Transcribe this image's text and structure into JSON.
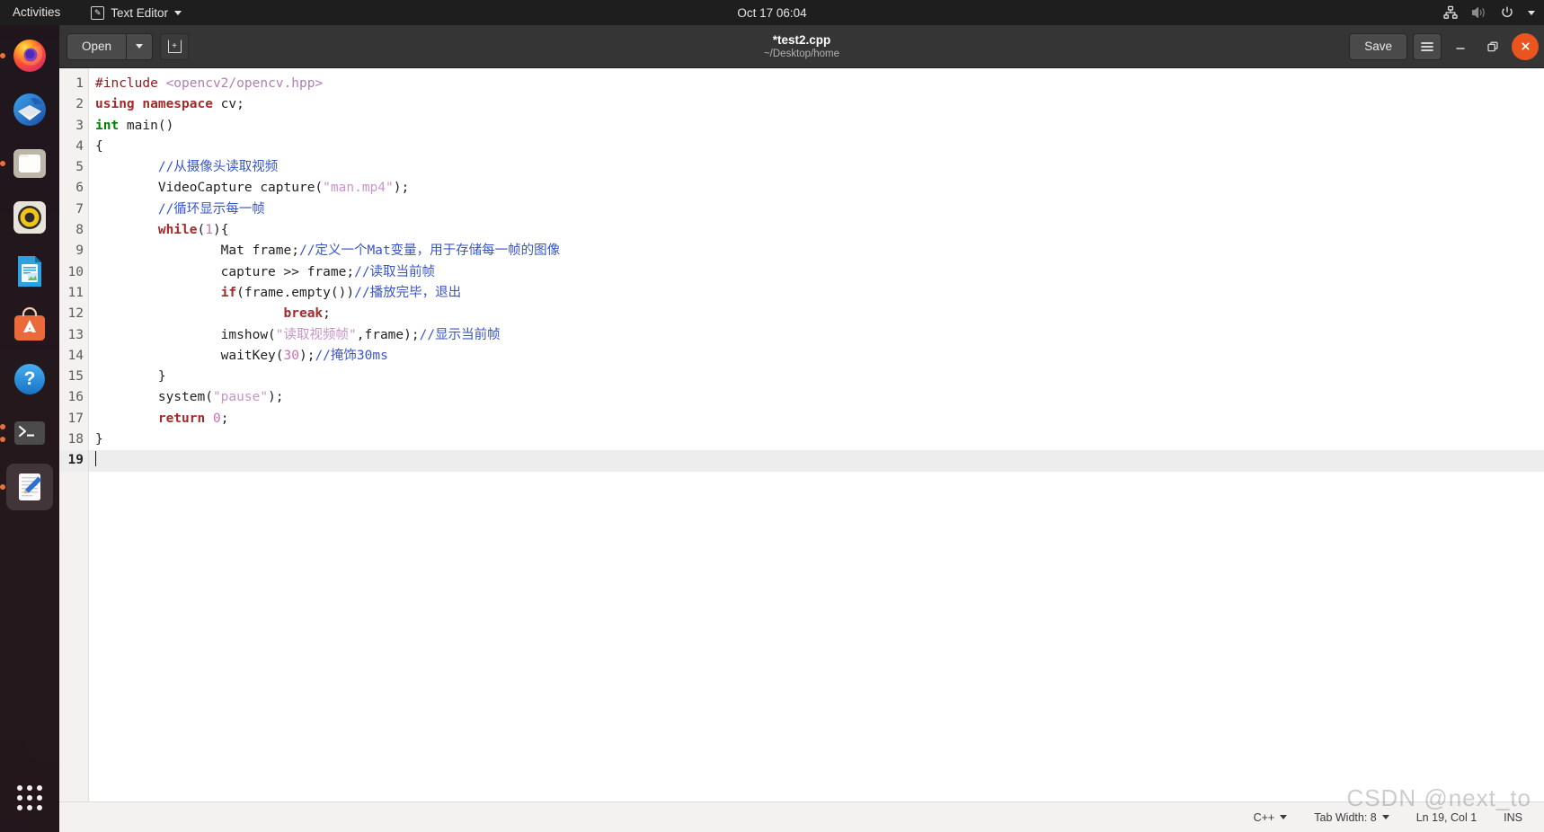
{
  "topbar": {
    "activities": "Activities",
    "app_name": "Text Editor",
    "app_icon": "text-editor-icon",
    "clock": "Oct 17  06:04",
    "tray": [
      {
        "name": "network-icon"
      },
      {
        "name": "volume-muted-icon"
      },
      {
        "name": "power-icon"
      },
      {
        "name": "chevron-down-icon"
      }
    ]
  },
  "dock": {
    "items": [
      {
        "name": "firefox",
        "label": "Firefox",
        "running": true
      },
      {
        "name": "thunderbird",
        "label": "Thunderbird",
        "running": false
      },
      {
        "name": "files",
        "label": "Files",
        "running": true
      },
      {
        "name": "rhythmbox",
        "label": "Rhythmbox",
        "running": false
      },
      {
        "name": "libreoffice-writer",
        "label": "LibreOffice Writer",
        "running": false
      },
      {
        "name": "ubuntu-software",
        "label": "Ubuntu Software",
        "running": false
      },
      {
        "name": "help",
        "label": "Help",
        "running": false
      },
      {
        "name": "terminal",
        "label": "Terminal",
        "running": true
      },
      {
        "name": "text-editor",
        "label": "Text Editor",
        "running": true,
        "active": true
      }
    ],
    "show_apps_label": "Show Applications"
  },
  "window": {
    "open_label": "Open",
    "open_menu_icon": "chevron-down-icon",
    "new_tab_icon": "new-document-icon",
    "title": "*test2.cpp",
    "subtitle": "~/Desktop/home",
    "save_label": "Save",
    "menu_icon": "hamburger-menu-icon",
    "minimize_icon": "minimize-icon",
    "maximize_icon": "maximize-icon",
    "close_icon": "close-icon"
  },
  "editor": {
    "current_line": 19,
    "lines": [
      {
        "n": 1,
        "tokens": [
          {
            "t": "#include ",
            "c": "pp"
          },
          {
            "t": "<opencv2/opencv.hpp>",
            "c": "inc"
          }
        ]
      },
      {
        "n": 2,
        "tokens": [
          {
            "t": "using namespace",
            "c": "k"
          },
          {
            "t": " cv;",
            "c": "pl"
          }
        ]
      },
      {
        "n": 3,
        "tokens": [
          {
            "t": "int",
            "c": "typ"
          },
          {
            "t": " main()",
            "c": "pl"
          }
        ]
      },
      {
        "n": 4,
        "tokens": [
          {
            "t": "{",
            "c": "pl"
          }
        ]
      },
      {
        "n": 5,
        "tokens": [
          {
            "t": "        ",
            "c": "pl"
          },
          {
            "t": "//从摄像头读取视频",
            "c": "cmt"
          }
        ]
      },
      {
        "n": 6,
        "tokens": [
          {
            "t": "        VideoCapture capture(",
            "c": "pl"
          },
          {
            "t": "\"man.mp4\"",
            "c": "str"
          },
          {
            "t": ");",
            "c": "pl"
          }
        ]
      },
      {
        "n": 7,
        "tokens": [
          {
            "t": "        ",
            "c": "pl"
          },
          {
            "t": "//循环显示每一帧",
            "c": "cmt"
          }
        ]
      },
      {
        "n": 8,
        "tokens": [
          {
            "t": "        ",
            "c": "pl"
          },
          {
            "t": "while",
            "c": "k"
          },
          {
            "t": "(",
            "c": "pl"
          },
          {
            "t": "1",
            "c": "num"
          },
          {
            "t": "){",
            "c": "pl"
          }
        ]
      },
      {
        "n": 9,
        "tokens": [
          {
            "t": "                Mat frame;",
            "c": "pl"
          },
          {
            "t": "//定义一个Mat变量，用于存储每一帧的图像",
            "c": "cmt"
          }
        ]
      },
      {
        "n": 10,
        "tokens": [
          {
            "t": "                capture >> frame;",
            "c": "pl"
          },
          {
            "t": "//读取当前帧",
            "c": "cmt"
          }
        ]
      },
      {
        "n": 11,
        "tokens": [
          {
            "t": "                ",
            "c": "pl"
          },
          {
            "t": "if",
            "c": "k"
          },
          {
            "t": "(frame.empty())",
            "c": "pl"
          },
          {
            "t": "//播放完毕，退出",
            "c": "cmt"
          }
        ]
      },
      {
        "n": 12,
        "tokens": [
          {
            "t": "                        ",
            "c": "pl"
          },
          {
            "t": "break",
            "c": "k"
          },
          {
            "t": ";",
            "c": "pl"
          }
        ]
      },
      {
        "n": 13,
        "tokens": [
          {
            "t": "                imshow(",
            "c": "pl"
          },
          {
            "t": "\"读取视频帧\"",
            "c": "str"
          },
          {
            "t": ",frame);",
            "c": "pl"
          },
          {
            "t": "//显示当前帧",
            "c": "cmt"
          }
        ]
      },
      {
        "n": 14,
        "tokens": [
          {
            "t": "                waitKey(",
            "c": "pl"
          },
          {
            "t": "30",
            "c": "num"
          },
          {
            "t": ");",
            "c": "pl"
          },
          {
            "t": "//掩饰30ms",
            "c": "cmt"
          }
        ]
      },
      {
        "n": 15,
        "tokens": [
          {
            "t": "        }",
            "c": "pl"
          }
        ]
      },
      {
        "n": 16,
        "tokens": [
          {
            "t": "        system(",
            "c": "pl"
          },
          {
            "t": "\"pause\"",
            "c": "str"
          },
          {
            "t": ");",
            "c": "pl"
          }
        ]
      },
      {
        "n": 17,
        "tokens": [
          {
            "t": "        ",
            "c": "pl"
          },
          {
            "t": "return",
            "c": "k"
          },
          {
            "t": " ",
            "c": "pl"
          },
          {
            "t": "0",
            "c": "num"
          },
          {
            "t": ";",
            "c": "pl"
          }
        ]
      },
      {
        "n": 18,
        "tokens": [
          {
            "t": "}",
            "c": "pl"
          }
        ]
      },
      {
        "n": 19,
        "tokens": []
      }
    ]
  },
  "statusbar": {
    "language": "C++",
    "tab_width": "Tab Width: 8",
    "position": "Ln 19, Col 1",
    "insert_mode": "INS"
  },
  "watermark": "CSDN @next_to"
}
